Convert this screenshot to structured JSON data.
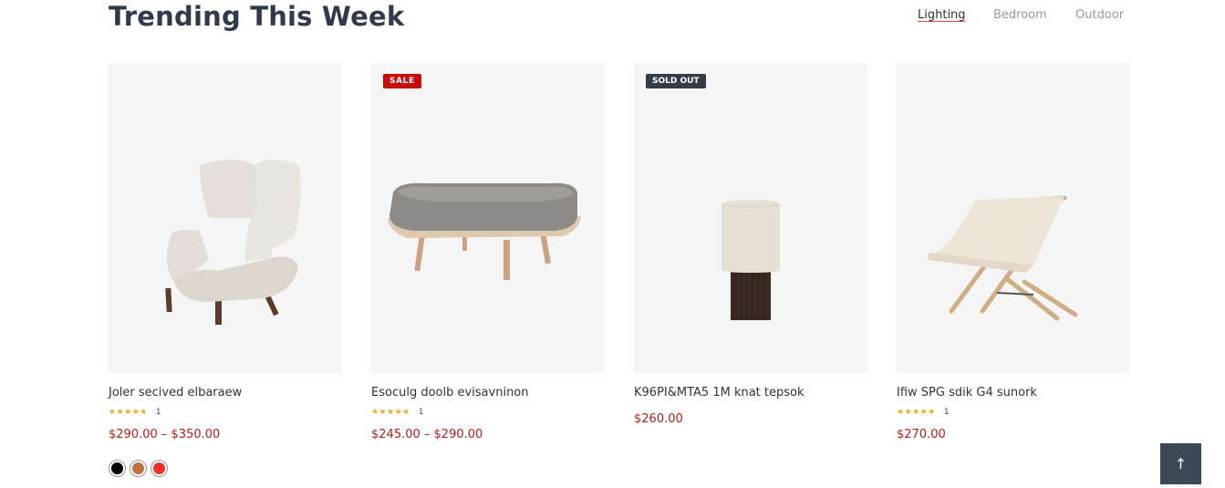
{
  "section": {
    "title": "Trending This Week"
  },
  "tabs": [
    {
      "label": "Lighting",
      "active": true
    },
    {
      "label": "Bedroom",
      "active": false
    },
    {
      "label": "Outdoor",
      "active": false
    }
  ],
  "products": [
    {
      "name": "Joler secived elbaraew",
      "badge": "",
      "rating_count": "1",
      "price": "$290.00 – $350.00",
      "stars": "★★★★★"
    },
    {
      "name": "Esoculg doolb evisavninon",
      "badge": "SALE",
      "rating_count": "1",
      "price": "$245.00 – $290.00",
      "stars": "★★★★★"
    },
    {
      "name": "K96PI&MTA5 1M knat tepsok",
      "badge": "SOLD OUT",
      "rating_count": "",
      "price": "$260.00",
      "stars": ""
    },
    {
      "name": "Ifiw SPG sdik G4 sunork",
      "badge": "",
      "rating_count": "1",
      "price": "$270.00",
      "stars": "★★★★★"
    }
  ],
  "swatches": [
    {
      "color": "#000000",
      "name": "black"
    },
    {
      "color": "#c0703a",
      "name": "brown"
    },
    {
      "color": "#f2322a",
      "name": "red"
    }
  ],
  "back_to_top": {
    "icon": "arrow-up-icon",
    "glyph": "↑"
  }
}
